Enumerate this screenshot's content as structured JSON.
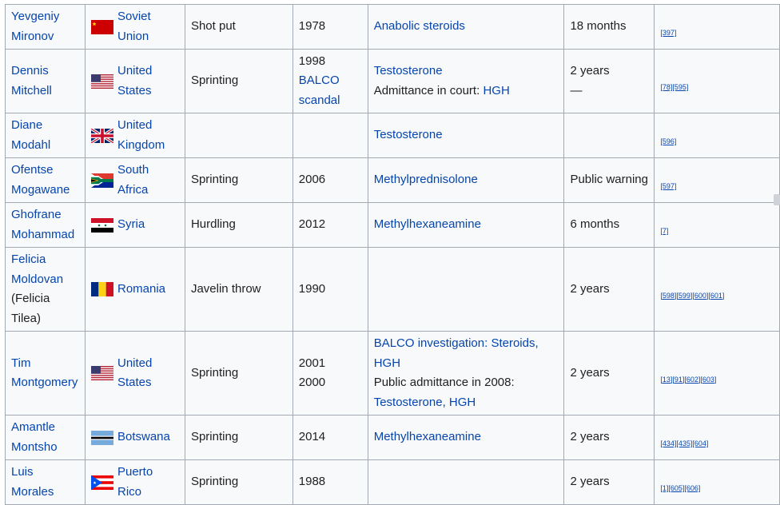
{
  "rows": [
    {
      "name": "Yevgeniy Mironov",
      "country": "Soviet Union",
      "flag": "soviet-union",
      "sport": "Shot put",
      "year": "1978",
      "substance": "Anabolic steroids",
      "sanction": "18 months",
      "ref": "[397]"
    },
    {
      "name": "Dennis Mitchell",
      "country": "United States",
      "flag": "united-states",
      "sport": "Sprinting",
      "year": "1998",
      "year_link": "BALCO scandal",
      "substance": "Testosterone",
      "substance_note": "Admittance in court: ",
      "substance_note_link": "HGH",
      "sanction": "2 years",
      "sanction_note": "—",
      "ref": "[78][595]"
    },
    {
      "name": "Diane Modahl",
      "country": "United Kingdom",
      "flag": "united-kingdom",
      "sport": "",
      "year": "",
      "substance": "Testosterone",
      "sanction": "",
      "ref": "[596]"
    },
    {
      "name": "Ofentse Mogawane",
      "country": "South Africa",
      "flag": "south-africa",
      "sport": "Sprinting",
      "year": "2006",
      "substance": "Methylprednisolone",
      "sanction": "Public warning",
      "ref": "[597]"
    },
    {
      "name": "Ghofrane Mohammad",
      "country": "Syria",
      "flag": "syria",
      "sport": "Hurdling",
      "year": "2012",
      "substance": "Methylhexaneamine",
      "sanction": "6 months",
      "ref": "[7]"
    },
    {
      "name": "Felicia Moldovan",
      "name_note": "(Felicia Tilea)",
      "country": "Romania",
      "flag": "romania",
      "sport": "Javelin throw",
      "year": "1990",
      "substance": "",
      "sanction": "2 years",
      "ref": "[598][599][600][601]"
    },
    {
      "name": "Tim Montgomery",
      "country": "United States",
      "flag": "united-states",
      "sport": "Sprinting",
      "year": "2001",
      "year2": "2000",
      "substance": "BALCO investigation: Steroids, HGH",
      "substance_note": "Public admittance in 2008: ",
      "substance_note_link": "Testosterone, HGH",
      "sanction": "2 years",
      "ref": "[13][91][602][603]"
    },
    {
      "name": "Amantle Montsho",
      "country": "Botswana",
      "flag": "botswana",
      "sport": "Sprinting",
      "year": "2014",
      "substance": "Methylhexaneamine",
      "sanction": "2 years",
      "ref": "[434][435][604]"
    },
    {
      "name": "Luis Morales",
      "country": "Puerto Rico",
      "flag": "puerto-rico",
      "sport": "Sprinting",
      "year": "1988",
      "substance": "",
      "sanction": "2 years",
      "ref": "[1][605][606]"
    }
  ]
}
